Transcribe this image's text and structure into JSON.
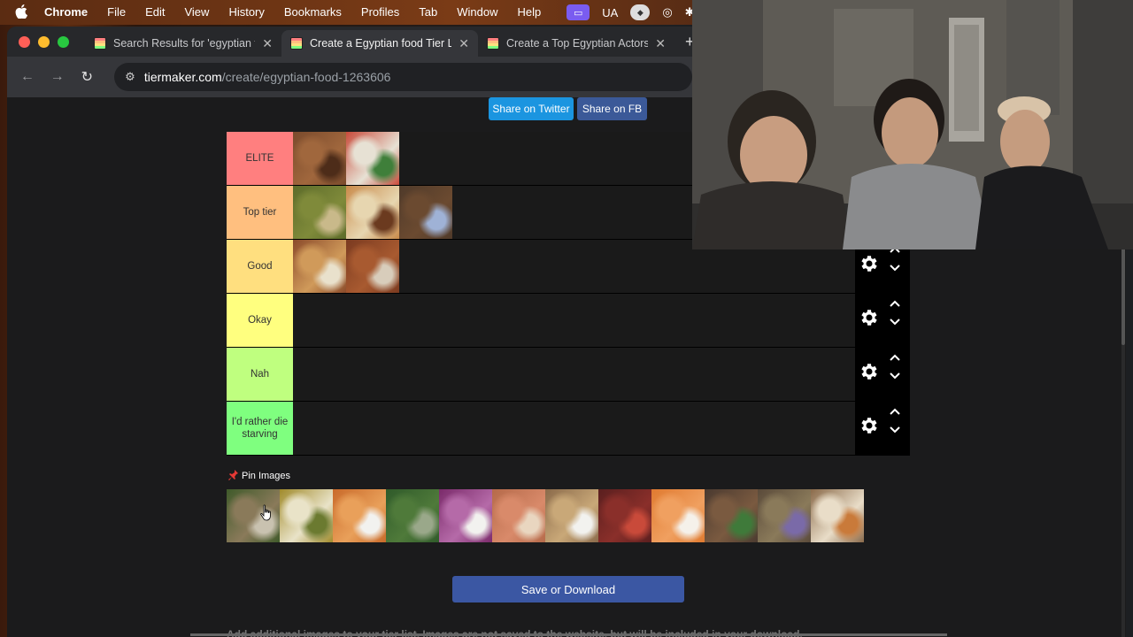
{
  "menubar": {
    "apple_icon": "apple-logo-icon",
    "app": "Chrome",
    "items": [
      "File",
      "Edit",
      "View",
      "History",
      "Bookmarks",
      "Profiles",
      "Tab",
      "Window",
      "Help"
    ],
    "status_ua": "UA"
  },
  "tabs": [
    {
      "title": "Search Results for 'egyptian f",
      "active": false
    },
    {
      "title": "Create a Egyptian food Tier L",
      "active": true
    },
    {
      "title": "Create a Top Egyptian Actors",
      "active": false
    }
  ],
  "address": {
    "host": "tiermaker.com",
    "path": "/create/egyptian-food-1263606"
  },
  "share": {
    "twitter": "Share on Twitter",
    "fb": "Share on FB"
  },
  "tiers": [
    {
      "label": "ELITE",
      "color": "#ff7f7f",
      "items": [
        "ful-kebab",
        "koshary-salad"
      ]
    },
    {
      "label": "Top tier",
      "color": "#ffbf7f",
      "items": [
        "mahshi",
        "hawawshi",
        "taameya"
      ]
    },
    {
      "label": "Good",
      "color": "#ffdf7f",
      "items": [
        "stuffed-eggplant",
        "ful-medames"
      ]
    },
    {
      "label": "Okay",
      "color": "#ffff7f",
      "items": []
    },
    {
      "label": "Nah",
      "color": "#bfff7f",
      "items": []
    },
    {
      "label": "I'd rather die starving",
      "color": "#7fff7f",
      "items": []
    }
  ],
  "pin": {
    "icon": "pushpin-icon",
    "label": "Pin Images"
  },
  "pool": [
    "mulukhiyah-plate",
    "fatta-bowl",
    "fried-fish",
    "molokhia-soup",
    "red-onion",
    "basbousa",
    "fish-plate",
    "kofta-patties",
    "round-breads",
    "kebab-grill",
    "meat-platter",
    "shawarma-wrap"
  ],
  "save_label": "Save or Download",
  "footer": "Add additional images to your tier list. Images are not saved to the website, but will be included in your download."
}
